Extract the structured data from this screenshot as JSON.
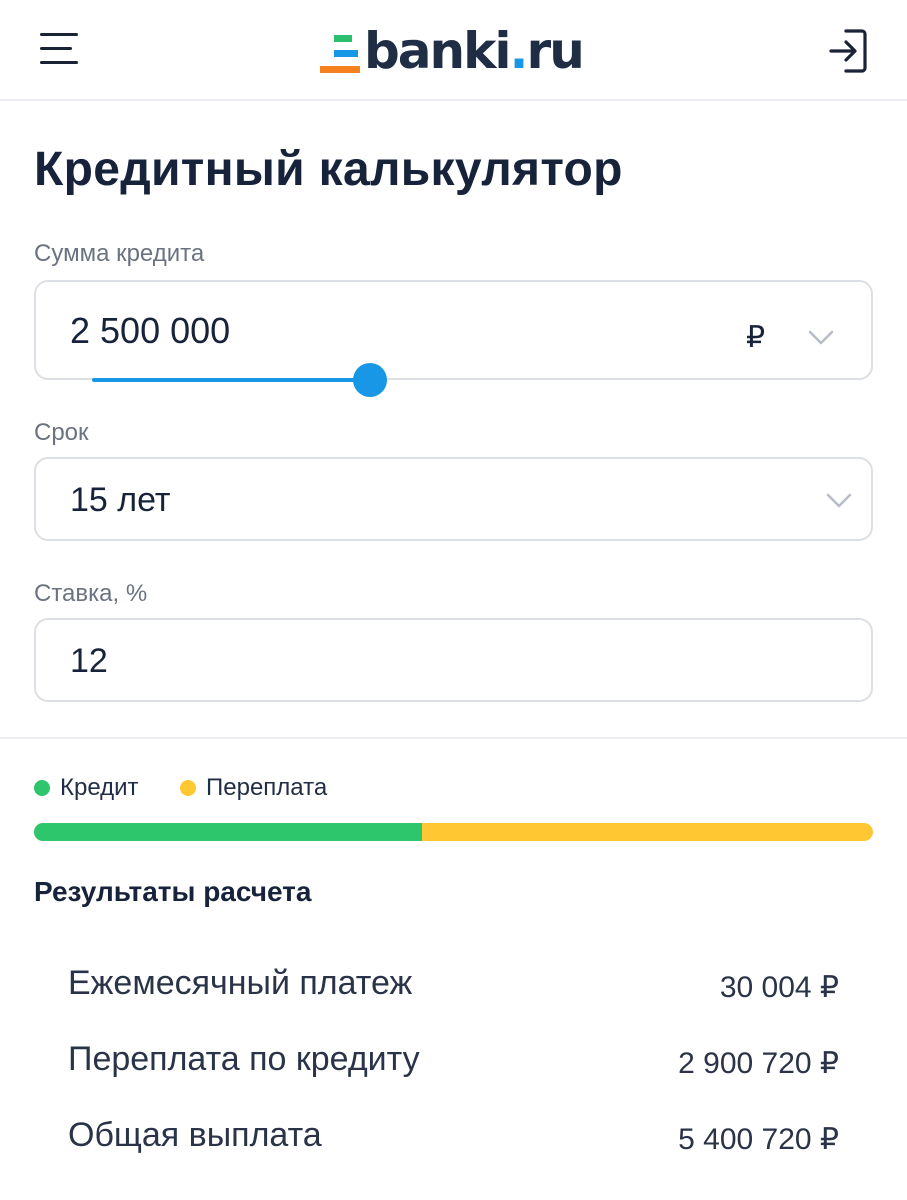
{
  "header": {
    "logo_text": "banki",
    "logo_dot": ".",
    "logo_domain": "ru",
    "menu_icon": "hamburger-menu-icon",
    "login_icon": "login-arrow-icon"
  },
  "page_title": "Кредитный калькулятор",
  "loan_amount": {
    "label": "Сумма кредита",
    "value": "2 500 000",
    "currency": "₽",
    "slider_fraction": 0.34
  },
  "term": {
    "label": "Срок",
    "value": "15 лет"
  },
  "rate": {
    "label": "Ставка, %",
    "value": "12"
  },
  "legend": {
    "credit_label": "Кредит",
    "overpay_label": "Переплата",
    "credit_color": "#2ec66d",
    "overpay_color": "#ffc832",
    "credit_share": 0.463
  },
  "results": {
    "title": "Результаты расчета",
    "rows": [
      {
        "label": "Ежемесячный платеж",
        "value": "30 004 ₽"
      },
      {
        "label": "Переплата по кредиту",
        "value": "2 900 720 ₽"
      },
      {
        "label": "Общая выплата",
        "value": "5 400 720 ₽"
      }
    ]
  }
}
